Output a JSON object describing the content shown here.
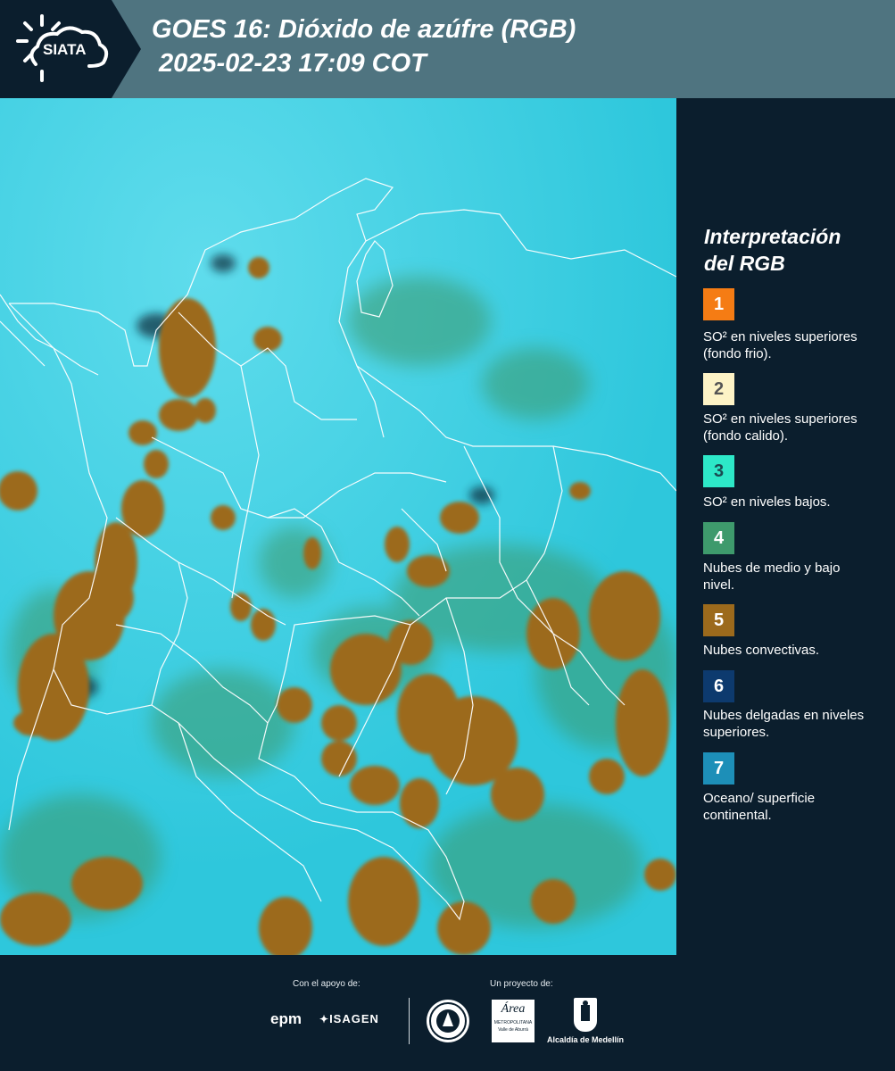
{
  "header": {
    "logo_text": "SIATA",
    "title_line_1": "GOES 16: Dióxido de azúfre (RGB)",
    "title_line_2": "2025-02-23 17:09 COT"
  },
  "legend": {
    "title_line_1": "Interpretación",
    "title_line_2": "del RGB",
    "items": [
      {
        "number": "1",
        "color": "#f57c14",
        "text_color": "#ffffff",
        "label": "SO² en niveles superiores (fondo frio)."
      },
      {
        "number": "2",
        "color": "#fdf3c6",
        "text_color": "#555555",
        "label": "SO² en niveles superiores (fondo calido)."
      },
      {
        "number": "3",
        "color": "#2de8c8",
        "text_color": "#1a4a50",
        "label": "SO² en niveles bajos."
      },
      {
        "number": "4",
        "color": "#3e9a6c",
        "text_color": "#ffffff",
        "label": "Nubes de medio y bajo nivel."
      },
      {
        "number": "5",
        "color": "#9c6a1c",
        "text_color": "#ffffff",
        "label": "Nubes convectivas."
      },
      {
        "number": "6",
        "color": "#0d3a6e",
        "text_color": "#ffffff",
        "label": "Nubes delgadas en niveles superiores."
      },
      {
        "number": "7",
        "color": "#1d8fb8",
        "text_color": "#ffffff",
        "label": "Oceano/ superficie continental."
      }
    ]
  },
  "footer": {
    "support_label": "Con el apoyo de:",
    "project_label": "Un proyecto de:",
    "epm": "epm",
    "isagen": "ISAGEN",
    "area_metro": "Área",
    "area_metro_sub": "METROPOLITANA",
    "area_metro_sub2": "Valle de Aburrá",
    "alcaldia": "Alcaldía de Medellín"
  },
  "colors": {
    "header_bg": "#4f7480",
    "panel_bg": "#0b1e2d",
    "map_cyan": "#33cfe0",
    "cloud_brown": "#9c6a1c",
    "cloud_green": "#3e9a6c",
    "border_white": "#ffffff"
  }
}
